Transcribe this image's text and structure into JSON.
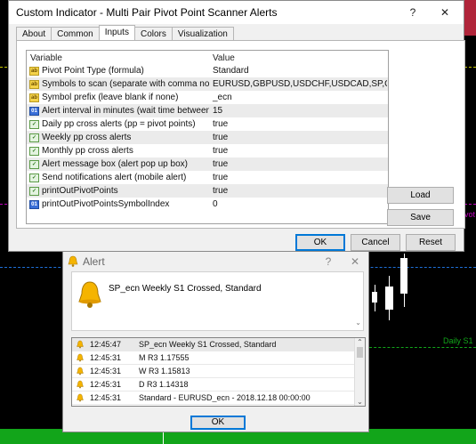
{
  "colors": {
    "accent": "#0078d7",
    "alert_bell": "#f5b400",
    "chart_green": "#12a51a",
    "chart_red": "#b0253a"
  },
  "chart": {
    "pivot_label": "Pivot",
    "daily_s1_label": "Daily S1"
  },
  "indicator_dialog": {
    "title": "Custom Indicator - Multi Pair Pivot Point Scanner Alerts",
    "help_label": "?",
    "close_label": "✕",
    "tabs": [
      {
        "label": "About"
      },
      {
        "label": "Common"
      },
      {
        "label": "Inputs"
      },
      {
        "label": "Colors"
      },
      {
        "label": "Visualization"
      }
    ],
    "columns": {
      "variable": "Variable",
      "value": "Value"
    },
    "inputs": [
      {
        "icon": "ab",
        "name": "Pivot Point Type (formula)",
        "value": "Standard"
      },
      {
        "icon": "ab",
        "name": "Symbols to scan (separate with comma no space)",
        "value": "EURUSD,GBPUSD,USDCHF,USDCAD,SP,CL"
      },
      {
        "icon": "ab",
        "name": "Symbol prefix (leave blank if none)",
        "value": "_ecn"
      },
      {
        "icon": "num",
        "name": "Alert interval in minutes (wait time between same...",
        "value": "15"
      },
      {
        "icon": "bool",
        "name": "Daily pp cross alerts (pp = pivot points)",
        "value": "true"
      },
      {
        "icon": "bool",
        "name": "Weekly pp cross alerts",
        "value": "true"
      },
      {
        "icon": "bool",
        "name": "Monthly pp cross alerts",
        "value": "true"
      },
      {
        "icon": "bool",
        "name": "Alert message box (alert pop up box)",
        "value": "true"
      },
      {
        "icon": "bool",
        "name": "Send notifications alert (mobile alert)",
        "value": "true"
      },
      {
        "icon": "bool",
        "name": "printOutPivotPoints",
        "value": "true"
      },
      {
        "icon": "num",
        "name": "printOutPivotPointsSymbolIndex",
        "value": "0"
      }
    ],
    "load_label": "Load",
    "save_label": "Save",
    "ok_label": "OK",
    "cancel_label": "Cancel",
    "reset_label": "Reset"
  },
  "alert_dialog": {
    "title": "Alert",
    "help_label": "?",
    "close_label": "✕",
    "message": "SP_ecn Weekly S1 Crossed, Standard",
    "log": [
      {
        "time": "12:45:47",
        "message": "SP_ecn Weekly S1 Crossed, Standard"
      },
      {
        "time": "12:45:31",
        "message": "M R3 1.17555"
      },
      {
        "time": "12:45:31",
        "message": "W R3 1.15813"
      },
      {
        "time": "12:45:31",
        "message": "D R3 1.14318"
      },
      {
        "time": "12:45:31",
        "message": "Standard - EURUSD_ecn - 2018.12.18 00:00:00"
      }
    ],
    "ok_label": "OK"
  }
}
